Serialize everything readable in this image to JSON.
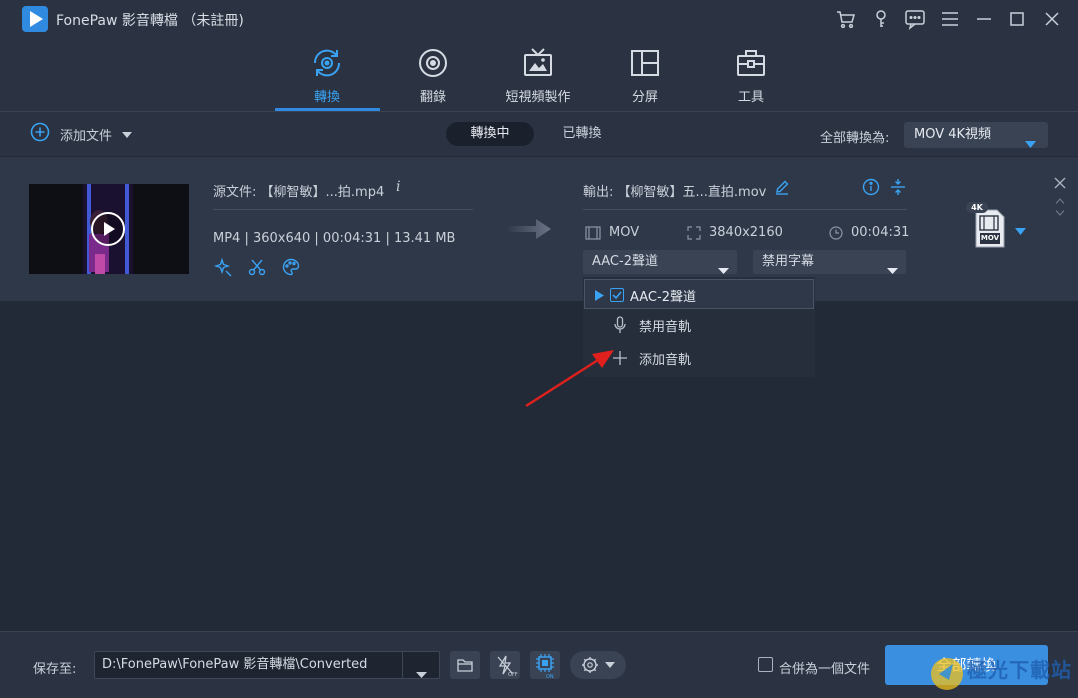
{
  "window": {
    "title": "FonePaw 影音轉檔 （未註冊)"
  },
  "tabs": [
    {
      "label": "轉換",
      "icon": "convert-icon",
      "active": true
    },
    {
      "label": "翻錄",
      "icon": "disc-icon",
      "active": false
    },
    {
      "label": "短視頻製作",
      "icon": "tv-icon",
      "active": false
    },
    {
      "label": "分屏",
      "icon": "split-screen-icon",
      "active": false
    },
    {
      "label": "工具",
      "icon": "toolbox-icon",
      "active": false
    }
  ],
  "toolbar": {
    "add_file": "添加文件",
    "seg_converting": "轉換中",
    "seg_converted": "已轉換",
    "convert_all_label": "全部轉換為:",
    "format_value": "MOV 4K視頻"
  },
  "file": {
    "source_label": "源文件: 【柳智敏】...拍.mp4",
    "source_meta": "MP4 | 360x640 | 00:04:31 | 13.41 MB",
    "output_label": "輸出: 【柳智敏】五...直拍.mov",
    "out_format": "MOV",
    "out_resolution": "3840x2160",
    "out_duration": "00:04:31",
    "audio_select": "AAC-2聲道",
    "subtitle_select": "禁用字幕",
    "badge_top": "4K",
    "badge_bottom": "MOV"
  },
  "audio_menu": {
    "items": [
      {
        "label": "AAC-2聲道",
        "checked": true
      },
      {
        "label": "禁用音軌"
      },
      {
        "label": "添加音軌"
      }
    ]
  },
  "bottom": {
    "save_label": "保存至:",
    "save_path": "D:\\FonePaw\\FonePaw 影音轉檔\\Converted",
    "merge_label": "合併為一個文件",
    "convert_all_button": "全部轉換",
    "watermark": "極光下載站"
  },
  "colors": {
    "accent": "#2f8ae0",
    "background": "#232a37",
    "panel": "#2b3342",
    "annotation_arrow": "#e0201c"
  }
}
